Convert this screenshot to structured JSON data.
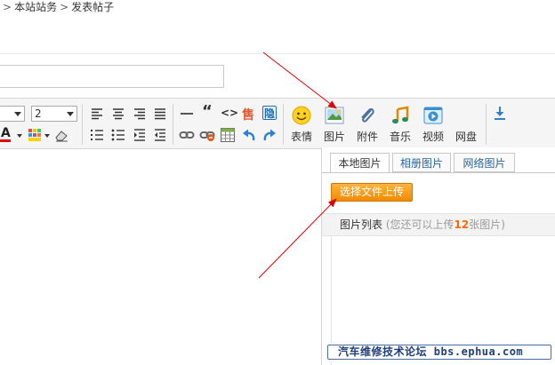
{
  "breadcrumb": {
    "item1": "本站站务",
    "item2": "发表帖子"
  },
  "title_input": {
    "value": ""
  },
  "toolbar": {
    "font_size_left_value": "",
    "font_size_value": "2",
    "font_color_letter": "A",
    "quote_glyph": "“",
    "code_glyph": "<>",
    "hide_glyph": "隐",
    "sell_glyph": "售",
    "emoji_label": "表情",
    "image_label": "图片",
    "attach_label": "附件",
    "music_label": "音乐",
    "video_label": "视频",
    "netdisk_label": "网盘"
  },
  "image_panel": {
    "tabs": [
      {
        "label": "本地图片",
        "active": true
      },
      {
        "label": "相册图片",
        "active": false
      },
      {
        "label": "网络图片",
        "active": false
      }
    ],
    "upload_button_label": "选择文件上传",
    "list_title": "图片列表",
    "quota_prefix": "(您还可以上传",
    "quota_count": "12",
    "quota_suffix": "张图片)"
  },
  "watermark": {
    "text": "汽车维修技术论坛 bbs.ephua.com"
  },
  "colors": {
    "accent_orange": "#f08a00",
    "annotation_red": "#e00000",
    "link_blue": "#2a6496",
    "quota_orange": "#ff6600"
  }
}
